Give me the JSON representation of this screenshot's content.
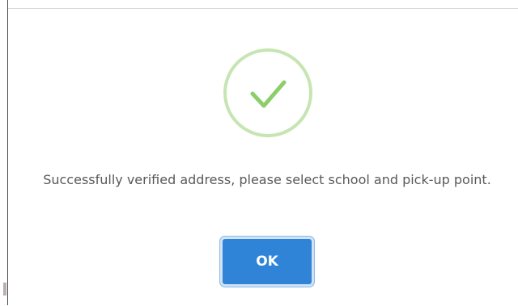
{
  "dialog": {
    "icon": "checkmark-success-icon",
    "message": "Successfully verified address, please select school and pick-up point.",
    "ok_label": "OK"
  },
  "colors": {
    "icon_ring": "#c6e5b3",
    "icon_check": "#8ccf6a",
    "button_bg": "#2f84d8",
    "button_text": "#ffffff",
    "message_text": "#595959"
  }
}
